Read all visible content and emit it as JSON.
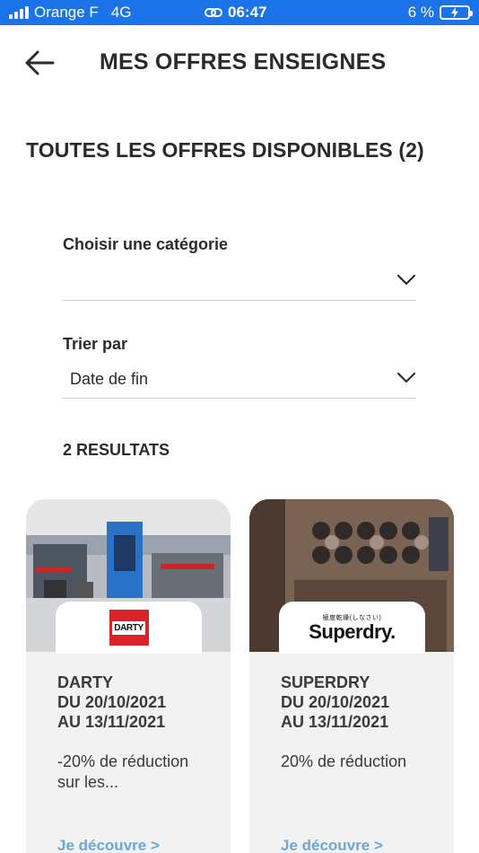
{
  "status_bar": {
    "carrier": "Orange F",
    "network": "4G",
    "time": "06:47",
    "battery": "6 %"
  },
  "header": {
    "title": "MES OFFRES ENSEIGNES"
  },
  "section": {
    "title": "TOUTES LES OFFRES DISPONIBLES (2)"
  },
  "filters": {
    "category": {
      "label": "Choisir une catégorie",
      "value": ""
    },
    "sort": {
      "label": "Trier par",
      "value": "Date de fin"
    }
  },
  "results": {
    "label": "2 RESULTATS"
  },
  "offers": [
    {
      "brand": "DARTY",
      "from": "DU 20/10/2021",
      "to": "AU 13/11/2021",
      "description": "-20% de réduction sur les...",
      "link": "Je découvre >",
      "logo_text": "DARTY"
    },
    {
      "brand": "SUPERDRY",
      "from": "DU 20/10/2021",
      "to": "AU 13/11/2021",
      "description": "20% de réduction",
      "link": "Je découvre >",
      "logo_text": "Superdry.",
      "logo_subtext": "極度乾燥(しなさい)"
    }
  ],
  "colors": {
    "status_bar": "#1a73e8",
    "link": "#6da7d4",
    "darty_red": "#d8232a",
    "card_bg": "#f2f2f2"
  }
}
